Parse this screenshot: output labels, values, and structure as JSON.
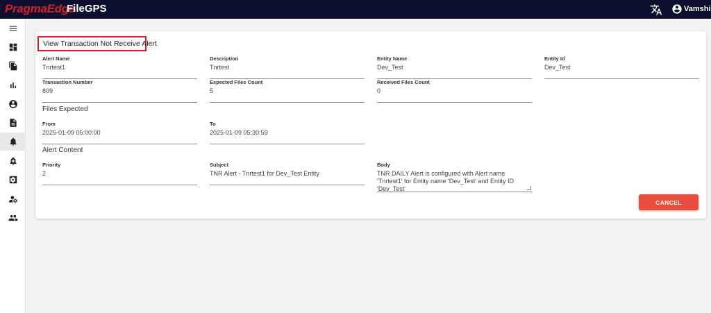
{
  "header": {
    "brand": "PragmaEdge",
    "product": "FileGPS",
    "user_name": "Vamshi",
    "translate_icon": "translate-icon",
    "user_icon": "account-circle-icon"
  },
  "colors": {
    "topbar": "#0c0f2e",
    "brand": "#d3202a",
    "cancel_button": "#e74c3c"
  },
  "sidebar": {
    "items": [
      {
        "icon": "menu-icon"
      },
      {
        "icon": "dashboard-icon"
      },
      {
        "icon": "files-icon"
      },
      {
        "icon": "bar-chart-icon"
      },
      {
        "icon": "account-icon"
      },
      {
        "icon": "document-icon"
      },
      {
        "icon": "alert-bell-icon",
        "active": true
      },
      {
        "icon": "alert-bell-add-icon"
      },
      {
        "icon": "settings-box-icon"
      },
      {
        "icon": "user-settings-icon"
      },
      {
        "icon": "group-icon"
      }
    ]
  },
  "card": {
    "title": "View Transaction Not Receive Alert",
    "fields": {
      "alert_name": {
        "label": "Alert Name",
        "value": "Tnrtest1"
      },
      "description": {
        "label": "Description",
        "value": "Tnrtest"
      },
      "entity_name": {
        "label": "Entity Name",
        "value": "Dev_Test"
      },
      "entity_id": {
        "label": "Entity Id",
        "value": "Dev_Test"
      },
      "transaction_number": {
        "label": "Transaction Number",
        "value": "809"
      },
      "expected_files_count": {
        "label": "Expected Files Count",
        "value": "5"
      },
      "received_files_count": {
        "label": "Received Files Count",
        "value": "0"
      },
      "from": {
        "label": "From",
        "value": "2025-01-09 05:00:00"
      },
      "to": {
        "label": "To",
        "value": "2025-01-09 05:30:59"
      },
      "priority": {
        "label": "Priority",
        "value": "2"
      },
      "subject": {
        "label": "Subject",
        "value": "TNR Alert - Tnrtest1 for Dev_Test Entity"
      },
      "body": {
        "label": "Body",
        "value": "TNR DAILY Alert is configured with Alert name 'Tnrtest1' for Entity name 'Dev_Test' and Entity ID 'Dev_Test'"
      }
    },
    "sections": {
      "files_expected": "Files Expected",
      "alert_content": "Alert Content"
    },
    "cancel_label": "CANCEL"
  }
}
